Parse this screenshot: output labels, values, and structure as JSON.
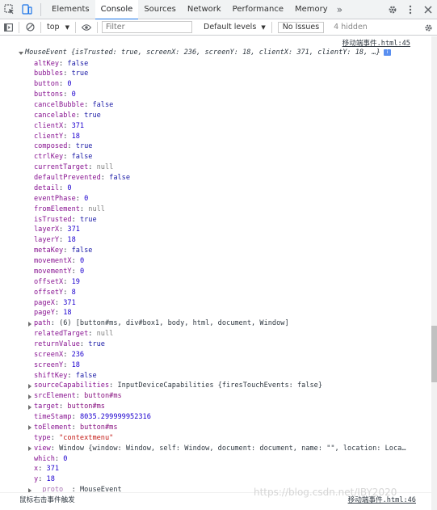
{
  "tabs": {
    "items": [
      "Elements",
      "Console",
      "Sources",
      "Network",
      "Performance",
      "Memory"
    ],
    "active": "Console",
    "more": "»"
  },
  "toolbar": {
    "context": "top",
    "filter_placeholder": "Filter",
    "levels": "Default levels",
    "no_issues": "No Issues",
    "hidden": "4 hidden"
  },
  "message": {
    "source": "移动端事件.html:45",
    "class_name": "MouseEvent",
    "summary": "{isTrusted: true, screenX: 236, screenY: 18, clientX: 371, clientY: 18, …}",
    "info_badge": "i",
    "properties": [
      {
        "key": "altKey",
        "value": "false",
        "type": "bool",
        "expandable": false
      },
      {
        "key": "bubbles",
        "value": "true",
        "type": "bool",
        "expandable": false
      },
      {
        "key": "button",
        "value": "0",
        "type": "num",
        "expandable": false
      },
      {
        "key": "buttons",
        "value": "0",
        "type": "num",
        "expandable": false
      },
      {
        "key": "cancelBubble",
        "value": "false",
        "type": "bool",
        "expandable": false
      },
      {
        "key": "cancelable",
        "value": "true",
        "type": "bool",
        "expandable": false
      },
      {
        "key": "clientX",
        "value": "371",
        "type": "num",
        "expandable": false
      },
      {
        "key": "clientY",
        "value": "18",
        "type": "num",
        "expandable": false
      },
      {
        "key": "composed",
        "value": "true",
        "type": "bool",
        "expandable": false
      },
      {
        "key": "ctrlKey",
        "value": "false",
        "type": "bool",
        "expandable": false
      },
      {
        "key": "currentTarget",
        "value": "null",
        "type": "null",
        "expandable": false
      },
      {
        "key": "defaultPrevented",
        "value": "false",
        "type": "bool",
        "expandable": false
      },
      {
        "key": "detail",
        "value": "0",
        "type": "num",
        "expandable": false
      },
      {
        "key": "eventPhase",
        "value": "0",
        "type": "num",
        "expandable": false
      },
      {
        "key": "fromElement",
        "value": "null",
        "type": "null",
        "expandable": false
      },
      {
        "key": "isTrusted",
        "value": "true",
        "type": "bool",
        "expandable": false
      },
      {
        "key": "layerX",
        "value": "371",
        "type": "num",
        "expandable": false
      },
      {
        "key": "layerY",
        "value": "18",
        "type": "num",
        "expandable": false
      },
      {
        "key": "metaKey",
        "value": "false",
        "type": "bool",
        "expandable": false
      },
      {
        "key": "movementX",
        "value": "0",
        "type": "num",
        "expandable": false
      },
      {
        "key": "movementY",
        "value": "0",
        "type": "num",
        "expandable": false
      },
      {
        "key": "offsetX",
        "value": "19",
        "type": "num",
        "expandable": false
      },
      {
        "key": "offsetY",
        "value": "8",
        "type": "num",
        "expandable": false
      },
      {
        "key": "pageX",
        "value": "371",
        "type": "num",
        "expandable": false
      },
      {
        "key": "pageY",
        "value": "18",
        "type": "num",
        "expandable": false
      },
      {
        "key": "path",
        "value": "(6) [button#ms, div#box1, body, html, document, Window]",
        "type": "obj",
        "expandable": true
      },
      {
        "key": "relatedTarget",
        "value": "null",
        "type": "null",
        "expandable": false
      },
      {
        "key": "returnValue",
        "value": "true",
        "type": "bool",
        "expandable": false
      },
      {
        "key": "screenX",
        "value": "236",
        "type": "num",
        "expandable": false
      },
      {
        "key": "screenY",
        "value": "18",
        "type": "num",
        "expandable": false
      },
      {
        "key": "shiftKey",
        "value": "false",
        "type": "bool",
        "expandable": false
      },
      {
        "key": "sourceCapabilities",
        "value": "InputDeviceCapabilities {firesTouchEvents: false}",
        "type": "obj",
        "expandable": true
      },
      {
        "key": "srcElement",
        "value": "button#ms",
        "type": "node",
        "expandable": true
      },
      {
        "key": "target",
        "value": "button#ms",
        "type": "node",
        "expandable": true
      },
      {
        "key": "timeStamp",
        "value": "8035.299999952316",
        "type": "num",
        "expandable": false
      },
      {
        "key": "toElement",
        "value": "button#ms",
        "type": "node",
        "expandable": true
      },
      {
        "key": "type",
        "value": "\"contextmenu\"",
        "type": "str",
        "expandable": false
      },
      {
        "key": "view",
        "value": "Window {window: Window, self: Window, document: document, name: \"\", location: Loca…",
        "type": "obj",
        "expandable": true
      },
      {
        "key": "which",
        "value": "0",
        "type": "num",
        "expandable": false
      },
      {
        "key": "x",
        "value": "371",
        "type": "num",
        "expandable": false
      },
      {
        "key": "y",
        "value": "18",
        "type": "num",
        "expandable": false
      },
      {
        "key": "__proto__",
        "value": "MouseEvent",
        "type": "obj",
        "expandable": true,
        "dim": true
      }
    ]
  },
  "bottom_message": {
    "text": "鼠标右击事件触发",
    "source": "移动端事件.html:46"
  },
  "watermark": "https://blog.csdn.net/IBY2020",
  "colors": {
    "key": "#881391",
    "bool": "#1a1aa6",
    "number": "#1c00cf",
    "string": "#c41a16",
    "null": "#808080",
    "accent": "#1a73e8"
  },
  "icons": [
    "inspect-element-icon",
    "device-toolbar-icon",
    "settings-gear-icon",
    "more-vertical-icon",
    "close-icon",
    "sidebar-toggle-icon",
    "clear-console-icon",
    "live-expression-eye-icon",
    "console-settings-gear-icon"
  ]
}
